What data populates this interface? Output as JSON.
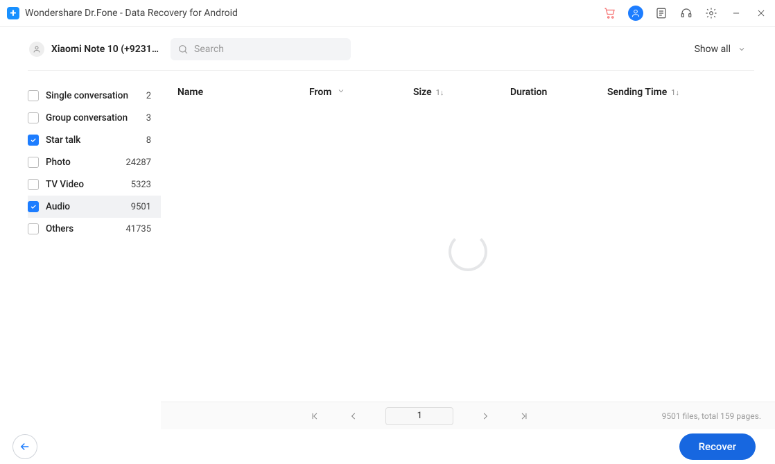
{
  "titlebar": {
    "title": "Wondershare Dr.Fone - Data Recovery for Android"
  },
  "toolbar": {
    "device_name": "Xiaomi Note 10 (+92315...",
    "search_placeholder": "Search",
    "filter_label": "Show all"
  },
  "sidebar": {
    "items": [
      {
        "label": "Single conversation",
        "count": "2",
        "checked": false,
        "selected": false
      },
      {
        "label": "Group conversation",
        "count": "3",
        "checked": false,
        "selected": false
      },
      {
        "label": "Star talk",
        "count": "8",
        "checked": true,
        "selected": false
      },
      {
        "label": "Photo",
        "count": "24287",
        "checked": false,
        "selected": false
      },
      {
        "label": "TV Video",
        "count": "5323",
        "checked": false,
        "selected": false
      },
      {
        "label": "Audio",
        "count": "9501",
        "checked": true,
        "selected": true
      },
      {
        "label": "Others",
        "count": "41735",
        "checked": false,
        "selected": false
      }
    ]
  },
  "table": {
    "columns": {
      "name": "Name",
      "from": "From",
      "size": "Size",
      "duration": "Duration",
      "sending": "Sending Time"
    },
    "sort_glyph": "1↓"
  },
  "pagination": {
    "page": "1",
    "summary": "9501 files, total 159 pages."
  },
  "footer": {
    "recover_label": "Recover"
  },
  "colors": {
    "accent": "#1d7dff",
    "recover": "#1767e0"
  }
}
